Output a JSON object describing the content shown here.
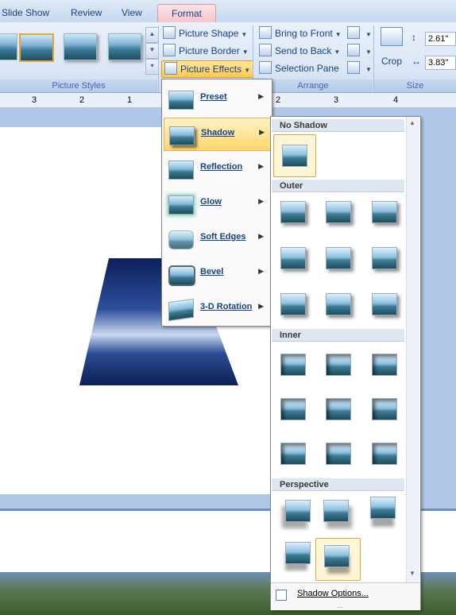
{
  "tabs": [
    "Slide Show",
    "Review",
    "View",
    "Format"
  ],
  "ribbon": {
    "picture_styles_label": "Picture Styles",
    "arrange_label": "Arrange",
    "size_label": "Size",
    "picture_shape": "Picture Shape",
    "picture_border": "Picture Border",
    "picture_effects": "Picture Effects",
    "bring_to_front": "Bring to Front",
    "send_to_back": "Send to Back",
    "selection_pane": "Selection Pane",
    "crop": "Crop",
    "height": "2.61\"",
    "width": "3.83\""
  },
  "ruler": {
    "marks": [
      "3",
      "2",
      "1",
      "2",
      "3",
      "4"
    ]
  },
  "effects_menu": [
    {
      "label": "Preset",
      "icon": "preset-icon"
    },
    {
      "label": "Shadow",
      "icon": "shadow-icon"
    },
    {
      "label": "Reflection",
      "icon": "reflection-icon"
    },
    {
      "label": "Glow",
      "icon": "glow-icon"
    },
    {
      "label": "Soft Edges",
      "icon": "soft-edges-icon"
    },
    {
      "label": "Bevel",
      "icon": "bevel-icon"
    },
    {
      "label": "3-D Rotation",
      "icon": "rotation-3d-icon"
    }
  ],
  "shadow_gallery": {
    "no_shadow": "No Shadow",
    "outer": "Outer",
    "inner": "Inner",
    "perspective": "Perspective",
    "options": "Shadow Options..."
  },
  "colors": {
    "accent_tab": "#f3c4cc",
    "highlight": "#ffd66e",
    "ribbon_text": "#15428b"
  }
}
